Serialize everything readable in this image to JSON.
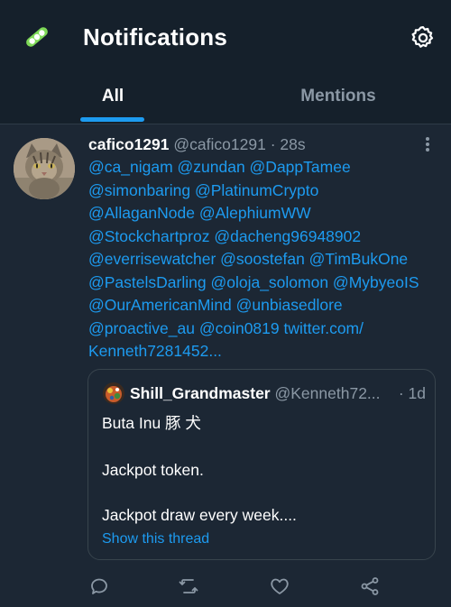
{
  "header": {
    "title": "Notifications",
    "tabs": [
      {
        "label": "All",
        "active": true
      },
      {
        "label": "Mentions",
        "active": false
      }
    ]
  },
  "tweet": {
    "author_name": "cafico1291",
    "author_handle": "@cafico1291",
    "separator": "·",
    "time": "28s",
    "body_lines": [
      "@ca_nigam @zundan @DappTamee",
      "@simonbaring @PlatinumCrypto",
      "@AllaganNode @AlephiumWW",
      "@Stockchartproz @dacheng96948902",
      "@everrisewatcher @soostefan @TimBukOne",
      "@PastelsDarling @oloja_solomon @MybyeoIS",
      "@OurAmericanMind @unbiasedlore",
      "@proactive_au @coin0819 twitter.com/",
      "Kenneth7281452..."
    ],
    "quote": {
      "name": "Shill_Grandmaster",
      "handle": "@Kenneth72...",
      "separator": "·",
      "time": "1d",
      "lines": [
        "Buta Inu 豚 犬",
        "Jackpot token.",
        "Jackpot draw every week...."
      ],
      "show_thread": "Show this thread"
    }
  },
  "actions": [
    {
      "name": "reply",
      "icon": "reply-icon"
    },
    {
      "name": "retweet",
      "icon": "retweet-icon"
    },
    {
      "name": "like",
      "icon": "heart-icon"
    },
    {
      "name": "share",
      "icon": "share-icon"
    }
  ],
  "colors": {
    "accent": "#1d9bf0",
    "background": "#1c2734",
    "header_bg": "#15202b",
    "secondary_text": "#8b98a5",
    "logo_green": "#7ed957"
  }
}
